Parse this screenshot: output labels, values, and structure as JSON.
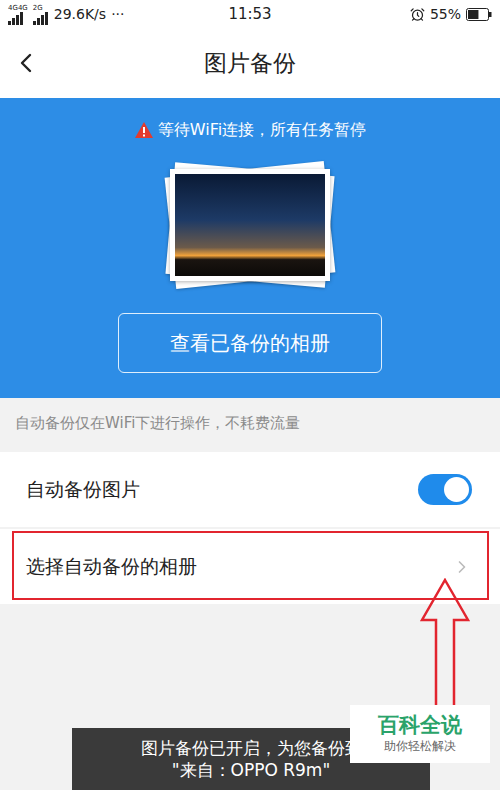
{
  "status_bar": {
    "signals": [
      {
        "label": "4G4G",
        "level": 1
      },
      {
        "label": "2G",
        "level": 1
      }
    ],
    "speed": "29.6K/s",
    "more": "···",
    "time": "11:53",
    "battery": {
      "text": "55%",
      "level": 0.55
    }
  },
  "header": {
    "title": "图片备份"
  },
  "banner": {
    "warning": "等待WiFi连接，所有任务暂停",
    "button": "查看已备份的相册"
  },
  "note": "自动备份仅在WiFi下进行操作，不耗费流量",
  "rows": [
    {
      "label": "自动备份图片",
      "kind": "toggle",
      "on": true,
      "highlighted": false
    },
    {
      "label": "选择自动备份的相册",
      "kind": "link",
      "highlighted": true
    }
  ],
  "toast": {
    "lines": [
      "图片备份已开启，为您备份到",
      "\"来自：OPPO R9m\""
    ]
  },
  "watermark": {
    "title": "百科全说",
    "subtitle": "助你轻松解决"
  }
}
